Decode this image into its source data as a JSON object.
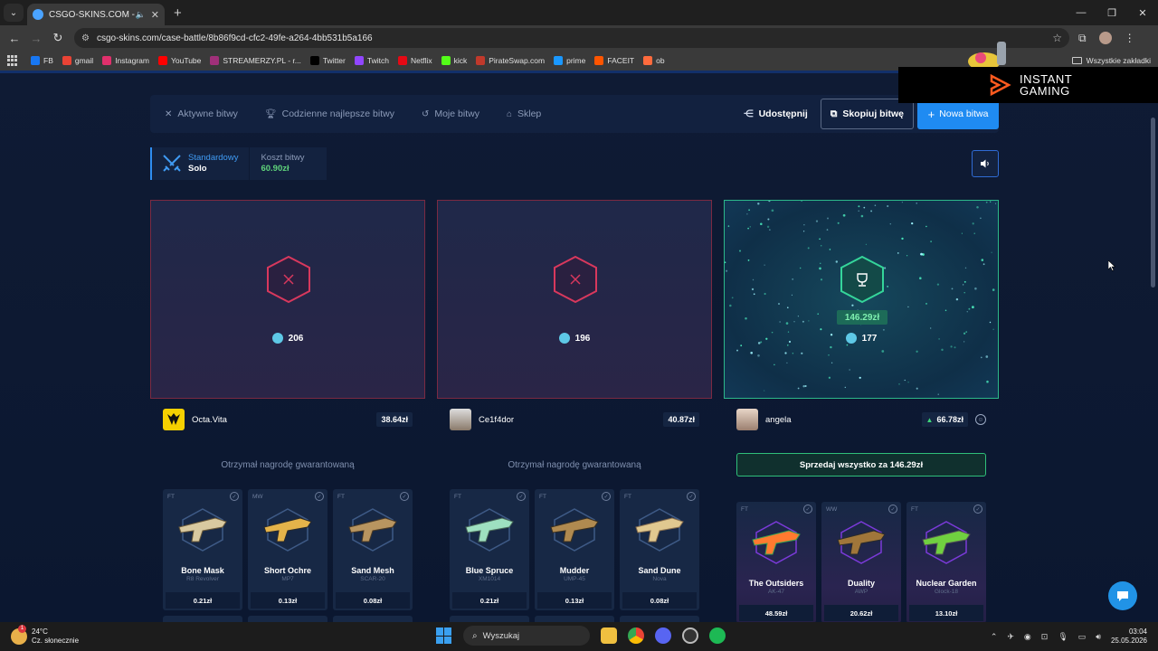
{
  "browser": {
    "tab_title": "CSGO-SKINS.COM - Najlep",
    "url": "csgo-skins.com/case-battle/8b86f9cd-cfc2-49fe-a264-4bb531b5a166",
    "bookmarks": [
      {
        "label": "FB",
        "color": "#1877f2"
      },
      {
        "label": "gmail",
        "color": "#ea4335"
      },
      {
        "label": "Instagram",
        "color": "#e1306c"
      },
      {
        "label": "YouTube",
        "color": "#ff0000"
      },
      {
        "label": "STREAMERZY.PL - r...",
        "color": "#a0307a"
      },
      {
        "label": "Twitter",
        "color": "#000000"
      },
      {
        "label": "Twitch",
        "color": "#9146ff"
      },
      {
        "label": "Netflix",
        "color": "#e50914"
      },
      {
        "label": "kick",
        "color": "#53fc18"
      },
      {
        "label": "PirateSwap.com",
        "color": "#c0392b"
      },
      {
        "label": "prime",
        "color": "#1a98ff"
      },
      {
        "label": "FACEIT",
        "color": "#ff5500"
      },
      {
        "label": "ob",
        "color": "#ff6b3d"
      }
    ],
    "bookmarks_folder": "Wszystkie zakładki"
  },
  "ad": {
    "line1": "INSTANT",
    "line2": "GAMING"
  },
  "nav": {
    "items": [
      "Aktywne bitwy",
      "Codzienne najlepsze bitwy",
      "Moje bitwy",
      "Sklep"
    ],
    "share": "Udostępnij",
    "copy": "Skopiuj bitwę",
    "new_battle": "Nowa bitwa"
  },
  "mode": {
    "label": "Standardowy",
    "value": "Solo",
    "cost_label": "Koszt bitwy",
    "cost_value": "60.90zł"
  },
  "players": [
    {
      "name": "Octa.Vita",
      "score": "206",
      "value": "38.64zł",
      "status": "Otrzymał nagrodę gwarantowaną",
      "items": [
        {
          "wear": "FT",
          "name": "Bone Mask",
          "type": "R8 Revolver",
          "price": "0.21zł"
        },
        {
          "wear": "MW",
          "name": "Short Ochre",
          "type": "MP7",
          "price": "0.13zł"
        },
        {
          "wear": "FT",
          "name": "Sand Mesh",
          "type": "SCAR-20",
          "price": "0.08zł"
        }
      ]
    },
    {
      "name": "Ce1f4dor",
      "score": "196",
      "value": "40.87zł",
      "status": "Otrzymał nagrodę gwarantowaną",
      "items": [
        {
          "wear": "FT",
          "name": "Blue Spruce",
          "type": "XM1014",
          "price": "0.21zł"
        },
        {
          "wear": "FT",
          "name": "Mudder",
          "type": "UMP-45",
          "price": "0.13zł"
        },
        {
          "wear": "FT",
          "name": "Sand Dune",
          "type": "Nova",
          "price": "0.08zł"
        }
      ]
    },
    {
      "name": "angela",
      "score": "177",
      "value": "66.78zł",
      "win_amount": "146.29zł",
      "sell_all": "Sprzedaj wszystko za 146.29zł",
      "items": [
        {
          "wear": "FT",
          "name": "The Outsiders",
          "type": "AK-47",
          "price": "48.59zł"
        },
        {
          "wear": "WW",
          "name": "Duality",
          "type": "AWP",
          "price": "20.62zł"
        },
        {
          "wear": "FT",
          "name": "Nuclear Garden",
          "type": "Glock-18",
          "price": "13.10zł"
        }
      ]
    }
  ],
  "taskbar": {
    "temp": "24°C",
    "weather": "Cz. słonecznie",
    "search": "Wyszukaj",
    "time": "03:04",
    "date": "25.05.2026",
    "notification_count": "1"
  },
  "colors": {
    "accent": "#1f8bf2",
    "loser_border": "#7b2a42",
    "winner_border": "#2cb88a",
    "gain": "#5fd47b"
  }
}
